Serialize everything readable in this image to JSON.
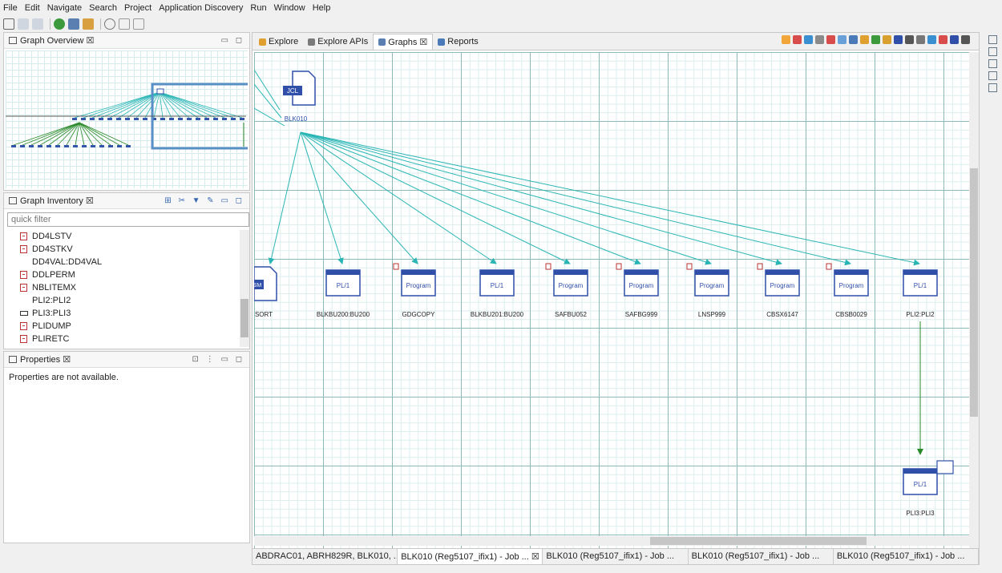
{
  "menu": [
    "File",
    "Edit",
    "Navigate",
    "Search",
    "Project",
    "Application Discovery",
    "Run",
    "Window",
    "Help"
  ],
  "overview": {
    "title": "Graph Overview ☒"
  },
  "inventory": {
    "title": "Graph Inventory ☒",
    "filter_placeholder": "quick filter",
    "items": [
      {
        "label": "DD4LSTV",
        "icon": "file"
      },
      {
        "label": "DD4STKV",
        "icon": "file"
      },
      {
        "label": "DD4VAL:DD4VAL",
        "icon": "none"
      },
      {
        "label": "DDLPERM",
        "icon": "file"
      },
      {
        "label": "NBLITEMX",
        "icon": "file"
      },
      {
        "label": "PLI2:PLI2",
        "icon": "none"
      },
      {
        "label": "PLI3:PLI3",
        "icon": "link"
      },
      {
        "label": "PLIDUMP",
        "icon": "file"
      },
      {
        "label": "PLIRETC",
        "icon": "file"
      }
    ]
  },
  "properties": {
    "title": "Properties ☒",
    "message": "Properties are not available."
  },
  "tabs": [
    {
      "label": "Explore",
      "color": "#e0a030",
      "active": false
    },
    {
      "label": "Explore APIs",
      "color": "#7a7a7a",
      "active": false
    },
    {
      "label": "Graphs ☒",
      "color": "#5a7fb0",
      "active": true
    },
    {
      "label": "Reports",
      "color": "#4a7ab8",
      "active": false
    }
  ],
  "graph": {
    "root": {
      "type": "JCL",
      "label": "BLK010"
    },
    "nodes": [
      {
        "type": "SM",
        "label": "SORT"
      },
      {
        "type": "PL/1",
        "label": "BLKBU200:BU200"
      },
      {
        "type": "Program",
        "label": "GDGCOPY"
      },
      {
        "type": "PL/1",
        "label": "BLKBU201:BU200"
      },
      {
        "type": "Program",
        "label": "SAFBU052"
      },
      {
        "type": "Program",
        "label": "SAFBG999"
      },
      {
        "type": "Program",
        "label": "LNSP999"
      },
      {
        "type": "Program",
        "label": "CBSX6147"
      },
      {
        "type": "Program",
        "label": "CBSB0029"
      },
      {
        "type": "PL/1",
        "label": "PLI2:PLI2"
      }
    ],
    "child": {
      "type": "PL/1",
      "label": "PLI3:PLI3"
    },
    "edge_color": "#2ab5b5",
    "child_edge_color": "#2a8a2a",
    "node_color": "#2f4fa8"
  },
  "doc_tabs": [
    "ABDRAC01, ABRH829R, BLK010, ...",
    "BLK010 (Reg5107_ifix1) - Job ... ☒",
    "BLK010 (Reg5107_ifix1) - Job ...",
    "BLK010 (Reg5107_ifix1) - Job ...",
    "BLK010 (Reg5107_ifix1) - Job ..."
  ]
}
